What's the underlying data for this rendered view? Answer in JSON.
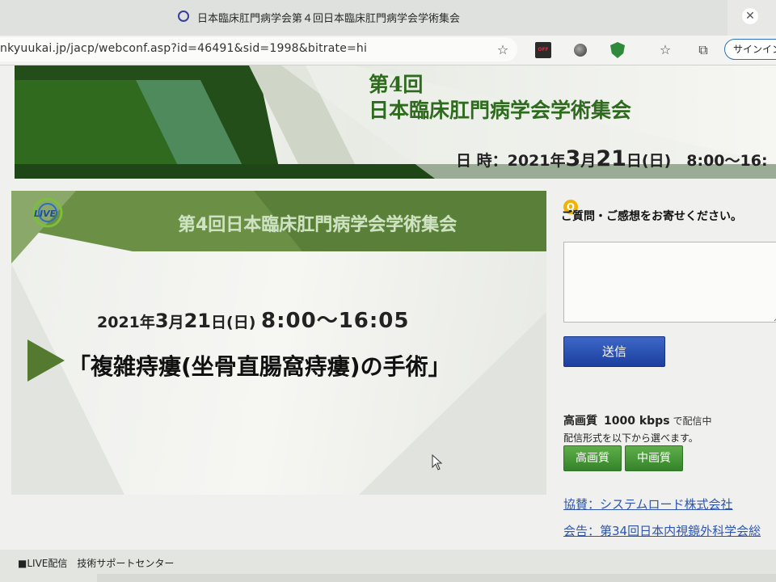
{
  "browser": {
    "tab_title": "日本臨床肛門病学会第４回日本臨床肛門病学会学術集会",
    "url": "nkyuukai.jp/jacp/webconf.asp?id=46491&sid=1998&bitrate=hi",
    "signin_label": "サインイン",
    "ext_off_label": "OFF",
    "icons": [
      "favorites-add-icon",
      "extension-off-icon",
      "extension-circle-icon",
      "shield-icon",
      "favorites-icon",
      "collections-icon"
    ]
  },
  "banner": {
    "title_line1": "第4回",
    "title_line2": "日本臨床肛門病学会学術集会",
    "date_prefix": "日 時：2021年",
    "date_month": "3",
    "date_month_unit": "月",
    "date_day": "21",
    "date_day_unit": "日",
    "date_suffix": "(日)　8:00〜16:"
  },
  "video": {
    "logo_text": "LIVE",
    "header": "第4回日本臨床肛門病学会学術集会",
    "date_prefix": "2021年",
    "date_month": "3",
    "date_month_unit": "月",
    "date_day": "21",
    "date_day_unit": "日",
    "date_weekday": "(日)",
    "time": "8:00〜16:05",
    "topic": "「複雑痔瘻(坐骨直腸窩痔瘻)の手術」"
  },
  "question": {
    "badge": "Q",
    "label": "ご質問・ご感想をお寄せください。",
    "textarea_value": "",
    "send_label": "送信"
  },
  "quality": {
    "current_label": "高画質",
    "bitrate": "1000 kbps",
    "status_suffix": "で配信中",
    "note": "配信形式を以下から選べます。",
    "buttons": [
      "高画質",
      "中画質"
    ]
  },
  "links": {
    "sponsor": "協賛：システムロード株式会社",
    "notice": "会告：第34回日本内視鏡外科学会総"
  },
  "footer": {
    "text": "■LIVE配信　技術サポートセンター"
  }
}
